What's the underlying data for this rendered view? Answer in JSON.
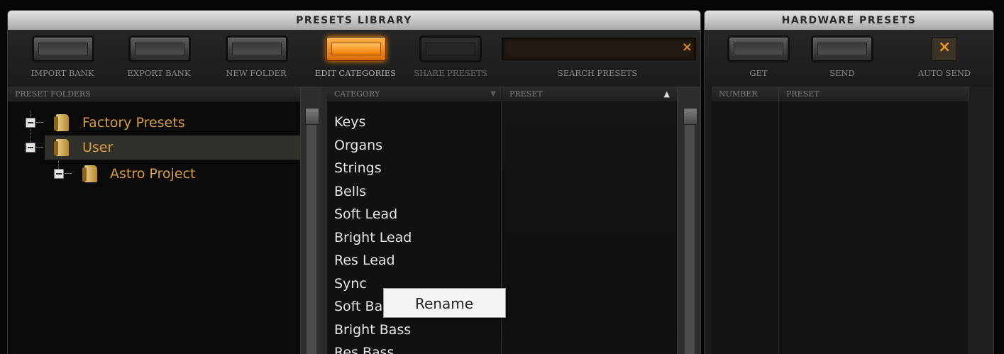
{
  "library": {
    "title": "PRESETS LIBRARY",
    "toolbar": {
      "import_label": "IMPORT BANK",
      "export_label": "EXPORT BANK",
      "new_folder_label": "NEW FOLDER",
      "edit_categories_label": "EDIT CATEGORIES",
      "share_label": "SHARE PRESETS",
      "search_label": "SEARCH PRESETS",
      "search_value": "",
      "clear_icon": "×"
    },
    "folders": {
      "header": "PRESET FOLDERS",
      "items": [
        {
          "label": "Factory Presets"
        },
        {
          "label": "User"
        },
        {
          "label": "Astro Project"
        }
      ]
    },
    "category": {
      "header": "CATEGORY",
      "sort_icon": "▼",
      "items": [
        "Keys",
        "Organs",
        "Strings",
        "Bells",
        "Soft Lead",
        "Bright Lead",
        "Res Lead",
        "Sync",
        "Soft Ba",
        "Bright Bass",
        "Res Bass"
      ]
    },
    "preset": {
      "header": "PRESET",
      "sort_icon": "▲"
    },
    "context_menu": {
      "rename_label": "Rename"
    },
    "accent_color": "#ff9a1a"
  },
  "hardware": {
    "title": "HARDWARE PRESETS",
    "get_label": "GET",
    "send_label": "SEND",
    "auto_send_label": "AUTO SEND",
    "auto_send_icon": "×",
    "number_header": "NUMBER",
    "preset_header": "PRESET"
  }
}
